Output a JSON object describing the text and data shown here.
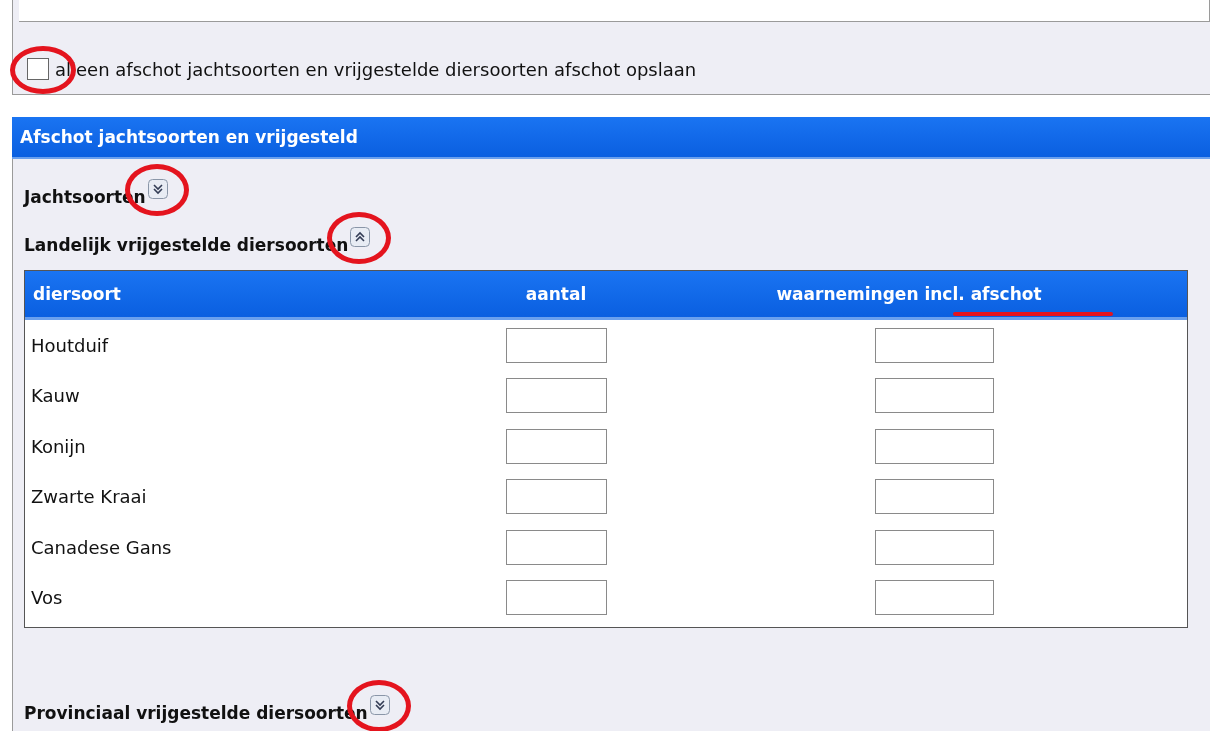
{
  "save_option": {
    "label": "alleen afschot jachtsoorten en vrijgestelde diersoorten afschot opslaan",
    "checked": false
  },
  "panel": {
    "title": "Afschot jachtsoorten en vrijgesteld",
    "sections": [
      {
        "title": "Jachtsoorten",
        "expanded": false
      },
      {
        "title": "Landelijk vrijgestelde diersoorten",
        "expanded": true,
        "table": {
          "columns": [
            "diersoort",
            "aantal",
            "waarnemingen incl. afschot"
          ],
          "rows": [
            {
              "species": "Houtduif"
            },
            {
              "species": "Kauw"
            },
            {
              "species": "Konijn"
            },
            {
              "species": "Zwarte Kraai"
            },
            {
              "species": "Canadese Gans"
            },
            {
              "species": "Vos"
            }
          ]
        }
      },
      {
        "title": "Provinciaal vrijgestelde diersoorten",
        "expanded": false
      }
    ]
  }
}
